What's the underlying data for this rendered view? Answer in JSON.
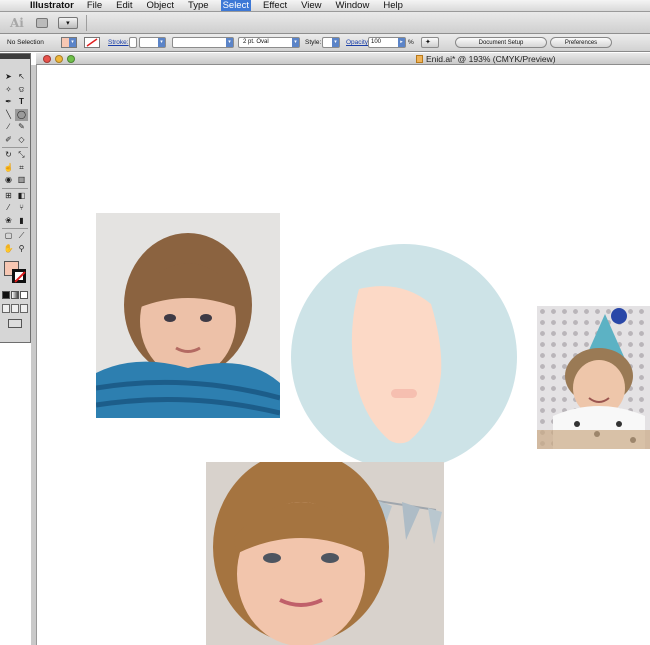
{
  "menubar": {
    "app_name": "Illustrator",
    "items": [
      "File",
      "Edit",
      "Object",
      "Type",
      "Select",
      "Effect",
      "View",
      "Window",
      "Help"
    ],
    "active_item": "Select"
  },
  "appbar": {
    "logo": "Ai"
  },
  "control": {
    "selection": "No Selection",
    "stroke_label": "Stroke:",
    "brush_value": "2 pt. Oval",
    "style_label": "Style:",
    "opacity_label": "Opacity:",
    "opacity_value": "100",
    "percent": "%",
    "document_setup": "Document Setup",
    "preferences": "Preferences"
  },
  "document": {
    "title": "Enid.ai* @ 193% (CMYK/Preview)"
  },
  "colors": {
    "fill": "#f7c7b3",
    "skin": "#fcd9c6",
    "face_circle": "#cde3e7",
    "mouth": "#f6bfb0",
    "menu_highlight": "#3d78d6"
  },
  "tools": [
    "selection-tool",
    "direct-selection-tool",
    "magic-wand-tool",
    "lasso-tool",
    "pen-tool",
    "type-tool",
    "line-segment-tool",
    "ellipse-tool",
    "paintbrush-tool",
    "pencil-tool",
    "blob-brush-tool",
    "eraser-tool",
    "rotate-tool",
    "scale-tool",
    "warp-tool",
    "free-transform-tool",
    "shape-builder-tool",
    "perspective-grid-tool",
    "mesh-tool",
    "gradient-tool",
    "eyedropper-tool",
    "blend-tool",
    "symbol-sprayer-tool",
    "column-graph-tool",
    "artboard-tool",
    "slice-tool",
    "hand-tool",
    "zoom-tool"
  ]
}
